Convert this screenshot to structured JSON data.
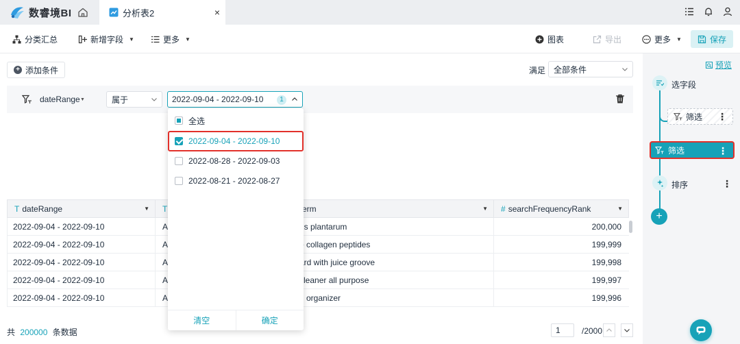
{
  "app": {
    "brand": "数睿境BI",
    "icon": "home-icon"
  },
  "tab": {
    "label": "分析表2",
    "close": "×"
  },
  "toolbar": {
    "group_summary": "分类汇总",
    "add_field": "新增字段",
    "more_left": "更多",
    "chart": "图表",
    "export": "导出",
    "more_right": "更多",
    "save": "保存"
  },
  "filter_panel": {
    "add_condition": "添加条件",
    "match_label": "满足",
    "match_value": "全部条件",
    "condition": {
      "field": "dateRange",
      "operator": "属于",
      "value": "2022-09-04 - 2022-09-10",
      "selected_count": "1"
    }
  },
  "dropdown": {
    "select_all": "全选",
    "options": [
      {
        "label": "2022-09-04 - 2022-09-10",
        "checked": true
      },
      {
        "label": "2022-08-28 - 2022-09-03",
        "checked": false
      },
      {
        "label": "2022-08-21 - 2022-08-27",
        "checked": false
      }
    ],
    "clear": "清空",
    "confirm": "确定"
  },
  "grid": {
    "columns": [
      {
        "type_glyph": "T",
        "name": "dateRange"
      },
      {
        "type_glyph": "T",
        "name": ""
      },
      {
        "type_glyph": "",
        "name": "erm"
      },
      {
        "type_glyph": "#",
        "name": "searchFrequencyRank"
      }
    ],
    "rows": [
      {
        "date": "2022-09-04 - 2022-09-10",
        "col2": "A",
        "term": "us plantarum",
        "rank": "200,000"
      },
      {
        "date": "2022-09-04 - 2022-09-10",
        "col2": "A",
        "term": "o collagen peptides",
        "rank": "199,999"
      },
      {
        "date": "2022-09-04 - 2022-09-10",
        "col2": "A",
        "term": "ard with juice groove",
        "rank": "199,998"
      },
      {
        "date": "2022-09-04 - 2022-09-10",
        "col2": "A",
        "term": "cleaner all purpose",
        "rank": "199,997"
      },
      {
        "date": "2022-09-04 - 2022-09-10",
        "col2": "A",
        "term": "g organizer",
        "rank": "199,996"
      }
    ]
  },
  "footer": {
    "total_prefix": "共",
    "total_count": "200000",
    "total_suffix": "条数据",
    "page": "1",
    "page_total": "/2000"
  },
  "flow": {
    "preview": "预览",
    "select_fields": "选字段",
    "sub_filter": "筛选",
    "active_filter": "筛选",
    "sort": "排序",
    "add": "+"
  },
  "colors": {
    "accent": "#17a2b8",
    "highlight": "#e2302a"
  }
}
